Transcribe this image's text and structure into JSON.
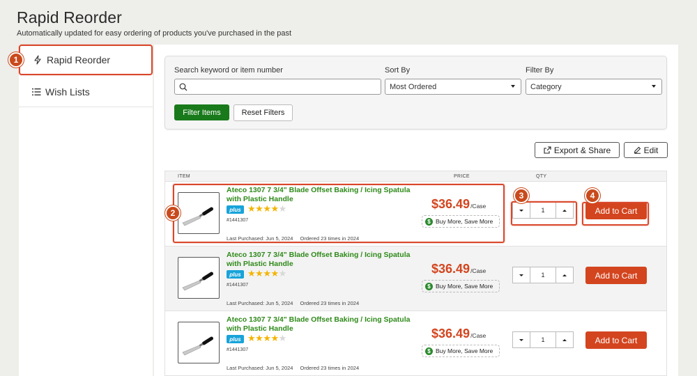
{
  "page": {
    "title": "Rapid Reorder",
    "subtitle": "Automatically updated for easy ordering of products you've purchased in the past"
  },
  "sidebar": {
    "items": [
      {
        "label": "Rapid Reorder",
        "icon": "lightning-icon"
      },
      {
        "label": "Wish Lists",
        "icon": "list-icon"
      }
    ]
  },
  "filters": {
    "search_label": "Search keyword or item number",
    "search_placeholder": "",
    "sort_label": "Sort By",
    "sort_value": "Most Ordered",
    "filter_label": "Filter By",
    "filter_value": "Category",
    "filter_button": "Filter Items",
    "reset_button": "Reset Filters"
  },
  "actions": {
    "export_label": "Export & Share",
    "edit_label": "Edit"
  },
  "table": {
    "headers": {
      "item": "ITEM",
      "price": "PRICE",
      "qty": "QTY"
    },
    "rows": [
      {
        "name": "Ateco 1307 7 3/4\" Blade Offset Baking / Icing Spatula with Plastic Handle",
        "badge": "plus",
        "rating": 4,
        "sku": "#1441307",
        "last_purchased": "Last Purchased: Jun 5, 2024",
        "ordered": "Ordered 23 times in 2024",
        "price": "$36.49",
        "unit": "/Case",
        "promo": "Buy More, Save More",
        "qty": "1",
        "cart_label": "Add to Cart"
      },
      {
        "name": "Ateco 1307 7 3/4\" Blade Offset Baking / Icing Spatula with Plastic Handle",
        "badge": "plus",
        "rating": 4,
        "sku": "#1441307",
        "last_purchased": "Last Purchased: Jun 5, 2024",
        "ordered": "Ordered 23 times in 2024",
        "price": "$36.49",
        "unit": "/Case",
        "promo": "Buy More, Save More",
        "qty": "1",
        "cart_label": "Add to Cart"
      },
      {
        "name": "Ateco 1307 7 3/4\" Blade Offset Baking / Icing Spatula with Plastic Handle",
        "badge": "plus",
        "rating": 4,
        "sku": "#1441307",
        "last_purchased": "Last Purchased: Jun 5, 2024",
        "ordered": "Ordered 23 times in 2024",
        "price": "$36.49",
        "unit": "/Case",
        "promo": "Buy More, Save More",
        "qty": "1",
        "cart_label": "Add to Cart"
      }
    ]
  },
  "callouts": [
    "1",
    "2",
    "3",
    "4"
  ],
  "colors": {
    "accent": "#d3451f",
    "primary_green": "#197a1b",
    "link_green": "#2f8a1a",
    "plus_blue": "#18a3d9",
    "star": "#f4b400",
    "highlight": "#d9472b"
  }
}
